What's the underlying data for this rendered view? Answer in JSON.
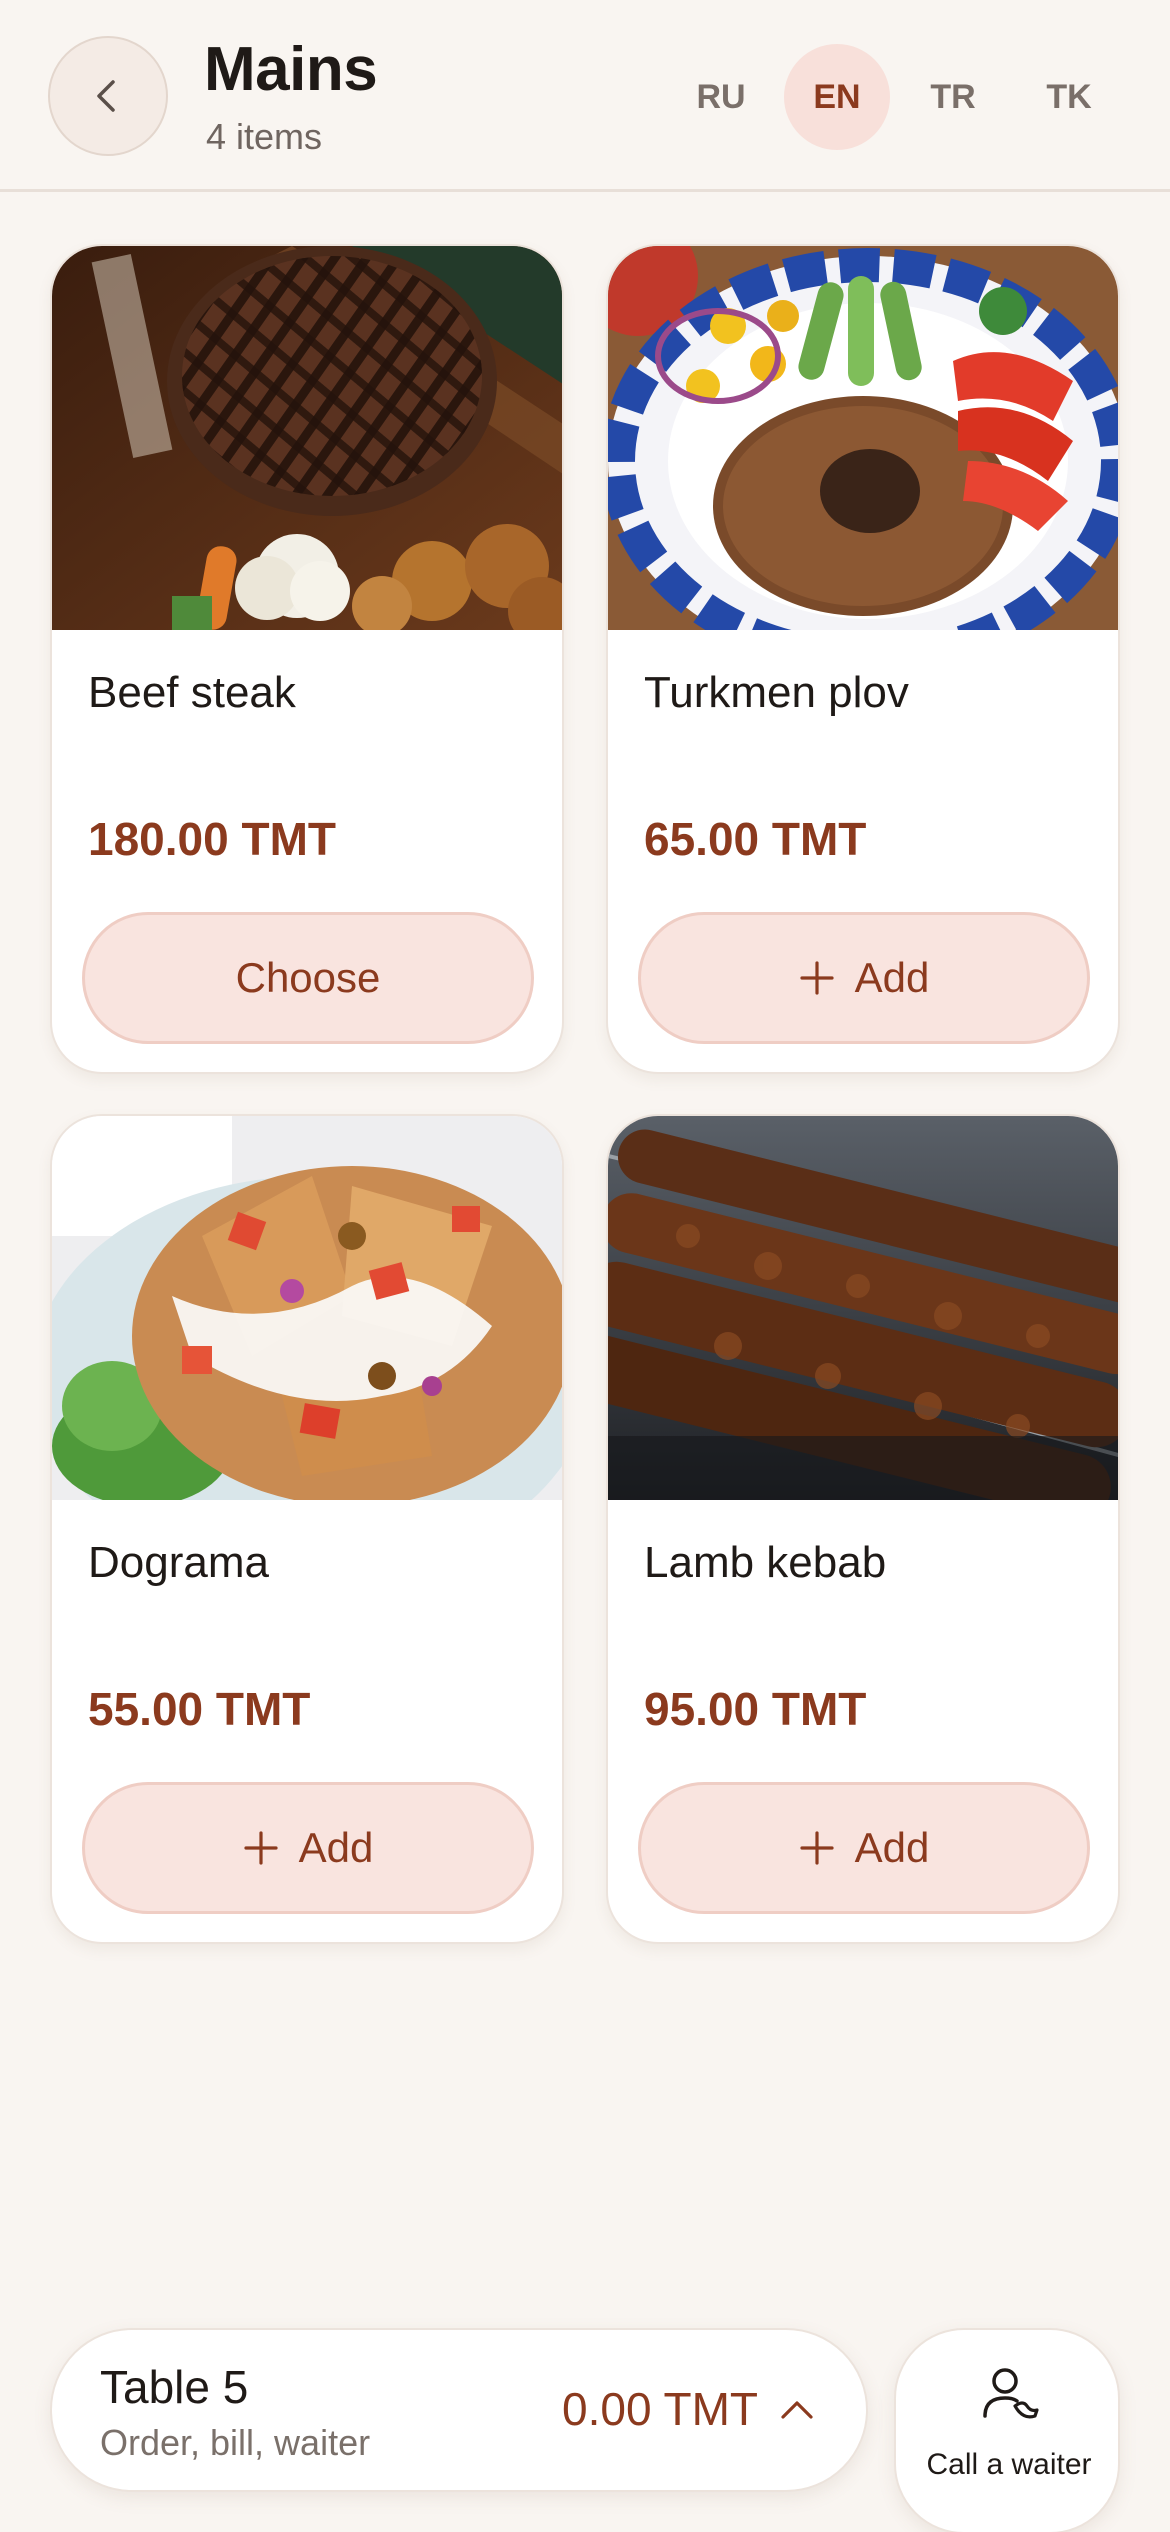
{
  "header": {
    "title": "Mains",
    "subtitle": "4 items",
    "languages": [
      {
        "code": "RU",
        "active": false
      },
      {
        "code": "EN",
        "active": true
      },
      {
        "code": "TR",
        "active": false
      },
      {
        "code": "TK",
        "active": false
      }
    ]
  },
  "items": [
    {
      "name": "Beef steak",
      "price": "180.00 TMT",
      "button": "Choose",
      "button_icon": "",
      "image": "beef-steak-photo"
    },
    {
      "name": "Turkmen plov",
      "price": "65.00 TMT",
      "button": "Add",
      "button_icon": "plus-icon",
      "image": "turkmen-plov-photo"
    },
    {
      "name": "Dograma",
      "price": "55.00 TMT",
      "button": "Add",
      "button_icon": "plus-icon",
      "image": "dograma-photo"
    },
    {
      "name": "Lamb kebab",
      "price": "95.00 TMT",
      "button": "Add",
      "button_icon": "plus-icon",
      "image": "lamb-kebab-photo"
    }
  ],
  "table_bar": {
    "table": "Table 5",
    "subtitle": "Order, bill, waiter",
    "total": "0.00 TMT"
  },
  "waiter": {
    "label": "Call a waiter"
  },
  "colors": {
    "background": "#f9f5f1",
    "accent": "#8b3a1e",
    "button_fill": "#f9e4df",
    "active_lang": "#f8e0da"
  }
}
